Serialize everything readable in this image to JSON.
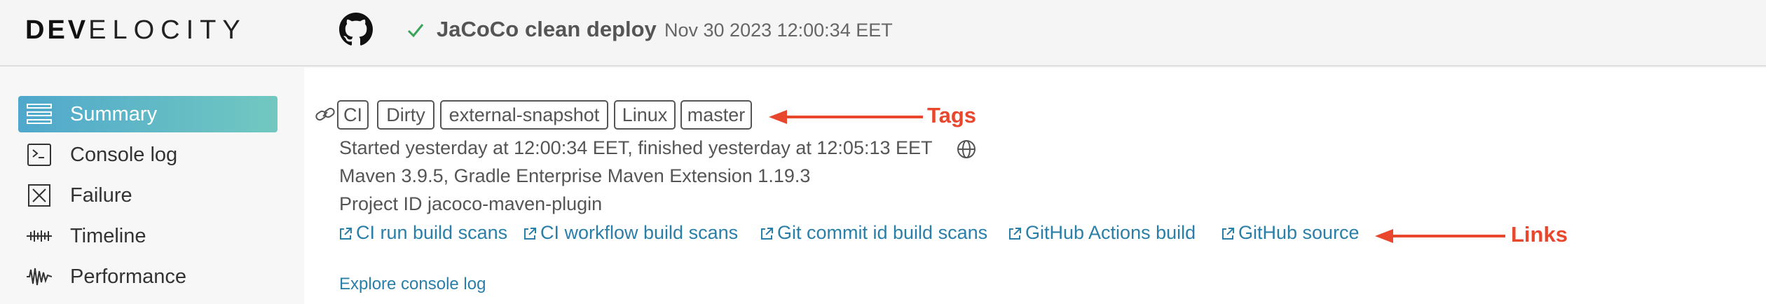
{
  "header": {
    "logo_bold": "DEV",
    "logo_light": "ELOCITY",
    "project": "JaCoCo",
    "goal": "clean deploy",
    "timestamp": "Nov 30 2023 12:00:34 EET"
  },
  "sidebar": {
    "items": [
      {
        "label": "Summary",
        "icon": "summary-icon",
        "active": true
      },
      {
        "label": "Console log",
        "icon": "console-icon",
        "active": false
      },
      {
        "label": "Failure",
        "icon": "failure-icon",
        "active": false
      },
      {
        "label": "Timeline",
        "icon": "timeline-icon",
        "active": false
      },
      {
        "label": "Performance",
        "icon": "performance-icon",
        "active": false
      }
    ]
  },
  "summary": {
    "tags": [
      "CI",
      "Dirty",
      "external-snapshot",
      "Linux",
      "master"
    ],
    "started_line": "Started yesterday at 12:00:34 EET, finished yesterday at 12:05:13 EET",
    "tool_line": "Maven 3.9.5,  Gradle Enterprise Maven Extension 1.19.3",
    "project_line": "Project ID jacoco-maven-plugin",
    "links": [
      "CI run build scans",
      "CI workflow build scans",
      "Git commit id build scans",
      "GitHub Actions build",
      "GitHub source"
    ],
    "explore": "Explore console log"
  },
  "annotations": {
    "tags_label": "Tags",
    "links_label": "Links",
    "color": "#e8472e"
  },
  "colors": {
    "accent_start": "#4fa8cc",
    "accent_end": "#72c8c0",
    "link": "#2a7fa8",
    "success": "#3aa35a"
  }
}
